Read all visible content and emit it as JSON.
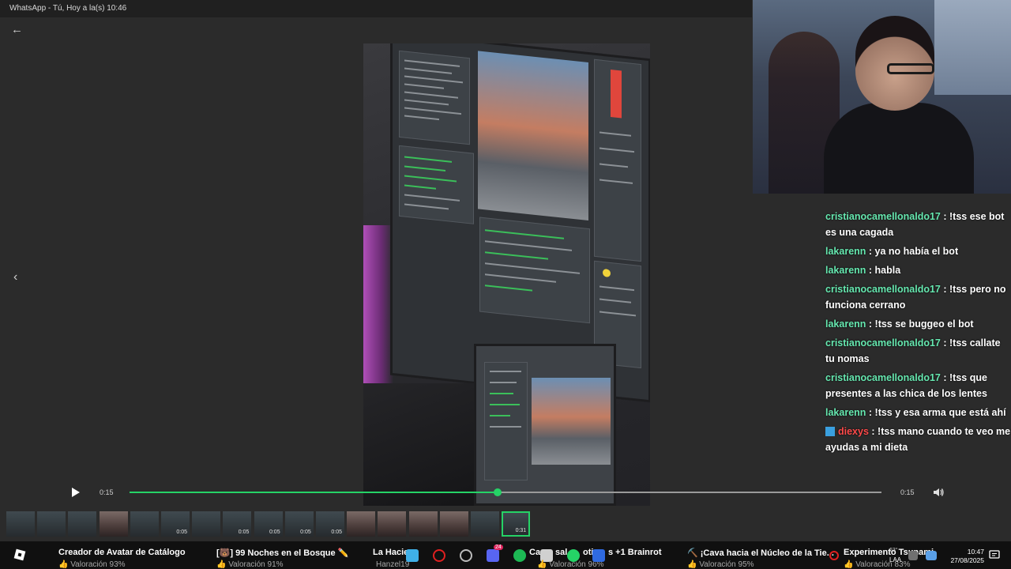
{
  "window": {
    "title": "WhatsApp - Tú, Hoy a la(s) 10:46"
  },
  "player": {
    "time_current": "0:15",
    "time_total": "0:15",
    "progress": 0.49
  },
  "thumbnails": [
    {
      "kind": "dark",
      "dur": ""
    },
    {
      "kind": "dark",
      "dur": ""
    },
    {
      "kind": "dark",
      "dur": ""
    },
    {
      "kind": "person",
      "dur": ""
    },
    {
      "kind": "dark",
      "dur": ""
    },
    {
      "kind": "dark",
      "dur": "0:05"
    },
    {
      "kind": "dark",
      "dur": ""
    },
    {
      "kind": "dark",
      "dur": "0:05"
    },
    {
      "kind": "dark",
      "dur": "0:05"
    },
    {
      "kind": "dark",
      "dur": "0:05"
    },
    {
      "kind": "dark",
      "dur": "0:05"
    },
    {
      "kind": "person",
      "dur": ""
    },
    {
      "kind": "person",
      "dur": ""
    },
    {
      "kind": "person",
      "dur": ""
    },
    {
      "kind": "person",
      "dur": ""
    },
    {
      "kind": "dark",
      "dur": ""
    },
    {
      "kind": "dark",
      "dur": "0:31",
      "selected": true
    }
  ],
  "chat": [
    {
      "user": "cristianocamellonaldo17",
      "text": "!tss ese bot es una cagada"
    },
    {
      "user": "lakarenn",
      "text": "ya no había el bot"
    },
    {
      "user": "lakarenn",
      "text": "habla"
    },
    {
      "user": "cristianocamellonaldo17",
      "text": "!tss pero no funciona cerrano"
    },
    {
      "user": "lakarenn",
      "text": "!tss se buggeo el bot"
    },
    {
      "user": "cristianocamellonaldo17",
      "text": "!tss callate tu nomas"
    },
    {
      "user": "cristianocamellonaldo17",
      "text": "!tss que presentes a las chica de los lentes"
    },
    {
      "user": "lakarenn",
      "text": "!tss y esa arma que está ahí"
    },
    {
      "user": "diexys",
      "text": "!tss mano cuando te veo me ayudas a mi dieta",
      "red": true,
      "badge": true
    }
  ],
  "taskbar": {
    "items": [
      {
        "title": "Creador de Avatar de Catálogo",
        "sub": "Valoración 93%"
      },
      {
        "title": "[🐻] 99 Noches en el Bosque ✏️",
        "sub": "Valoración 91%"
      },
      {
        "title": "La Hacie",
        "sub": "Hanzel19"
      },
      {
        "title": "Ca",
        "sub": ""
      },
      {
        "title": "sal",
        "sub": "Valoración 96%"
      },
      {
        "title": "oti",
        "sub": ""
      },
      {
        "title": "s +1 Brainrot",
        "sub": ""
      },
      {
        "title": "⛏️ ¡Cava hacia el Núcleo de la Tie...",
        "sub": "Valoración 95%"
      },
      {
        "title": "Experimento Tsunami",
        "sub": "Valoración 83%"
      }
    ],
    "tray_lang": "LAA",
    "tray_temp": "63°",
    "clock_time": "10:47",
    "clock_date": "27/08/2025",
    "discord_badge": "24"
  }
}
